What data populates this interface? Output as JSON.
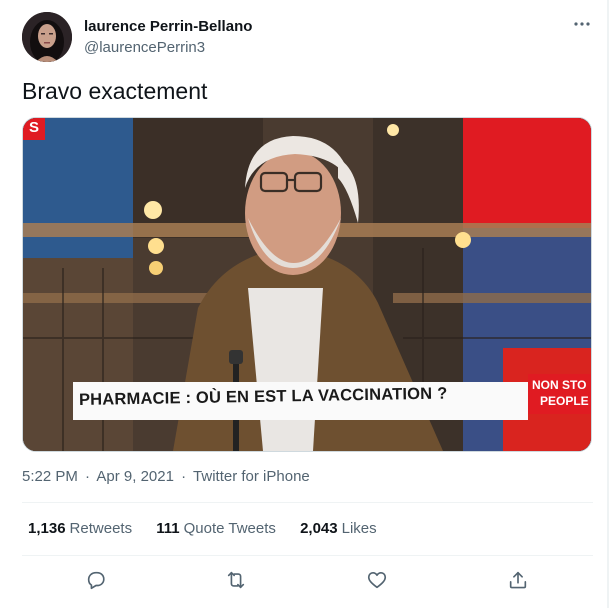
{
  "author": {
    "display_name": "laurence Perrin-Bellano",
    "handle": "@laurencePerrin3",
    "avatar_icon": "profile-photo"
  },
  "tweet": {
    "text": "Bravo exactement"
  },
  "media": {
    "chyron_text": "PHARMACIE : OÙ EN EST LA VACCINATION ?",
    "channel_corner": "S",
    "channel_tag_line1": "NON STO",
    "channel_tag_line2": "PEOPLE"
  },
  "meta": {
    "time": "5:22 PM",
    "date": "Apr 9, 2021",
    "source": "Twitter for iPhone",
    "sep": "·"
  },
  "stats": {
    "retweets_count": "1,136",
    "retweets_label": "Retweets",
    "quotes_count": "111",
    "quotes_label": "Quote Tweets",
    "likes_count": "2,043",
    "likes_label": "Likes"
  },
  "icons": [
    "more-icon",
    "reply-icon",
    "retweet-icon",
    "like-icon",
    "share-icon"
  ],
  "colors": {
    "text_primary": "#0f1419",
    "text_secondary": "#536471",
    "divider": "#eff3f4",
    "tv_red": "#e01b22"
  }
}
